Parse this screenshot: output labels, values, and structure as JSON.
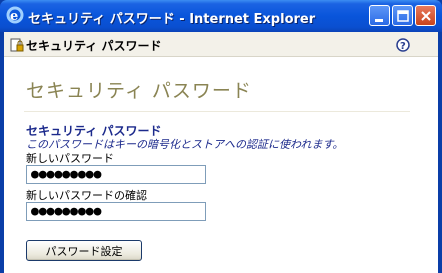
{
  "window": {
    "title": "セキュリティ パスワード - Internet Explorer",
    "icon": "internet-explorer-icon",
    "controls": {
      "minimize": "minimize-icon",
      "maximize": "maximize-icon",
      "close": "close-icon"
    }
  },
  "toolbar": {
    "title": "セキュリティ パスワード",
    "icon": "lock-page-icon",
    "help_icon": "help-icon"
  },
  "page": {
    "heading": "セキュリティ パスワード",
    "section_title": "セキュリティ パスワード",
    "section_desc": "このパスワードはキーの暗号化とストアへの認証に使われます。",
    "new_password_label": "新しいパスワード",
    "new_password_value": "●●●●●●●●●",
    "confirm_label": "新しいパスワードの確認",
    "confirm_value": "●●●●●●●●●",
    "set_button": "パスワード設定"
  },
  "colors": {
    "titlebar": "#0955db",
    "heading": "#8a8453",
    "section_text": "#1c2a8c"
  }
}
